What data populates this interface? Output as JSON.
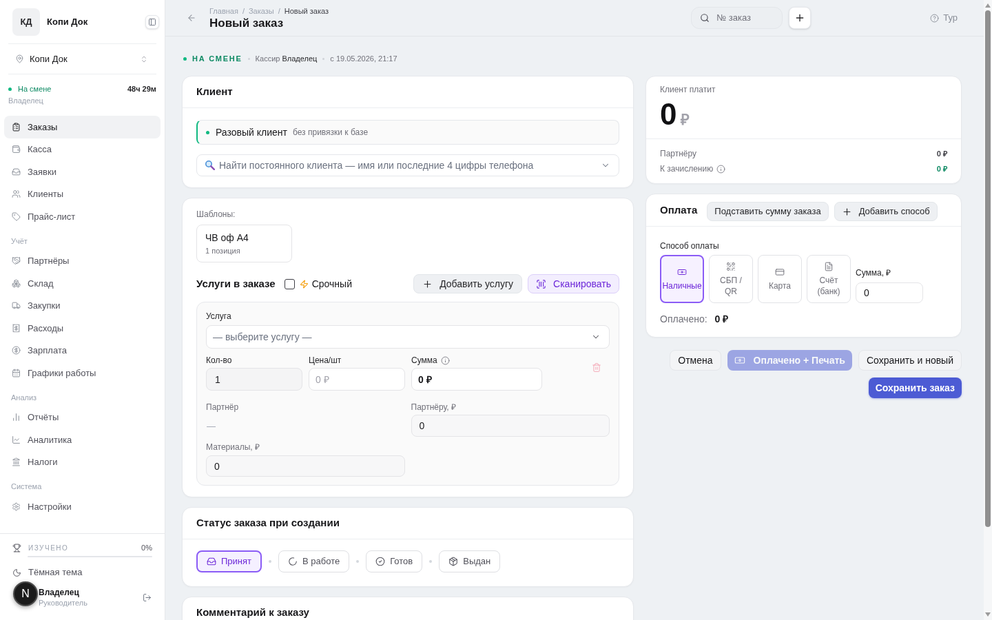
{
  "sidebar": {
    "workspace": {
      "initials": "КД",
      "name": "Копи Док"
    },
    "location": "Копи Док",
    "shift": {
      "status": "На смене",
      "duration": "48ч 29м",
      "role": "Владелец"
    },
    "nav_groups": [
      {
        "items": [
          {
            "label": "Заказы",
            "selected": true
          },
          {
            "label": "Касса",
            "selected": false
          },
          {
            "label": "Заявки",
            "selected": false
          },
          {
            "label": "Клиенты",
            "selected": false
          },
          {
            "label": "Прайс-лист",
            "selected": false
          }
        ]
      },
      {
        "title": "Учёт",
        "items": [
          {
            "label": "Партнёры",
            "selected": false
          },
          {
            "label": "Склад",
            "selected": false
          },
          {
            "label": "Закупки",
            "selected": false
          },
          {
            "label": "Расходы",
            "selected": false
          },
          {
            "label": "Зарплата",
            "selected": false
          },
          {
            "label": "Графики работы",
            "selected": false
          }
        ]
      },
      {
        "title": "Анализ",
        "items": [
          {
            "label": "Отчёты",
            "selected": false
          },
          {
            "label": "Аналитика",
            "selected": false
          },
          {
            "label": "Налоги",
            "selected": false
          }
        ]
      },
      {
        "title": "Система",
        "items": [
          {
            "label": "Настройки",
            "selected": false
          }
        ]
      }
    ],
    "progress": {
      "label": "ИЗУЧЕНО",
      "reading": "0%",
      "level": 0
    },
    "theme_toggle": "Тёмная тема",
    "user": {
      "name": "Владелец",
      "role": "Руководитель"
    }
  },
  "dev_badge": "N",
  "header": {
    "breadcrumbs": [
      "Главная",
      "Заказы",
      "Новый заказ"
    ],
    "separator": "/",
    "title": "Новый заказ",
    "search": {
      "placeholder": "№ заказ"
    },
    "tour": "Тур"
  },
  "shift_line": {
    "status": "НА СМЕНЕ",
    "cashier": "Кассир **Владелец**",
    "since": "с 19.05.2026, 21:17"
  },
  "client": {
    "title": "Клиент",
    "one_time": {
      "label": "Разовый клиент",
      "hint": "без привязки к базе"
    },
    "search": {
      "placeholder": "Найти постоянного клиента — имя или последние 4 цифры телефона"
    }
  },
  "services": {
    "templates_label": "Шаблоны:",
    "templates": [
      {
        "name": "ЧВ оф А4",
        "count": "1 позиция"
      }
    ],
    "title": "Услуги в заказе",
    "urgent": {
      "label": "Срочный",
      "checked": false
    },
    "buttons": [
      {
        "label": "Добавить услугу",
        "kind": "add"
      },
      {
        "label": "Сканировать",
        "kind": "scan"
      }
    ],
    "items": [
      {
        "service": {
          "label": "Услуга",
          "placeholder": "— выберите услугу —"
        },
        "quantity": {
          "label": "Кол-во",
          "value": "1"
        },
        "price": {
          "label": "Цена/шт",
          "placeholder": "0 ₽"
        },
        "sum": {
          "label": "Сумма",
          "value": "0 ₽"
        },
        "partner": {
          "label": "Партнёр",
          "value": "—"
        },
        "partner_share": {
          "label": "Партнёру, ₽",
          "value": "0"
        },
        "materials": {
          "label": "Материалы, ₽",
          "value": "0"
        }
      }
    ]
  },
  "order_status": {
    "title": "Статус заказа при создании",
    "steps": [
      {
        "label": "Принят",
        "selected": true
      },
      {
        "label": "В работе",
        "selected": false
      },
      {
        "label": "Готов",
        "selected": false
      },
      {
        "label": "Выдан",
        "selected": false
      }
    ]
  },
  "comment": {
    "title": "Комментарий к заказу"
  },
  "summary": {
    "label": "Клиент платит",
    "amount": "0",
    "currency": "₽",
    "rows": [
      {
        "label": "Партнёру",
        "value": "0 ₽",
        "kind": "plain",
        "info": false
      },
      {
        "label": "К зачислению",
        "value": "0 ₽",
        "kind": "payout",
        "info": true
      }
    ]
  },
  "payment": {
    "title": "Оплата",
    "buttons": [
      {
        "label": "Подставить сумму заказа",
        "kind": "fill"
      },
      {
        "label": "Добавить способ",
        "kind": "add"
      }
    ],
    "method_label": "Способ оплаты",
    "methods": [
      {
        "label": "Наличные",
        "selected": true
      },
      {
        "label": "СБП / QR",
        "selected": false
      },
      {
        "label": "Карта",
        "selected": false
      },
      {
        "label": "Счёт (банк)",
        "selected": false
      }
    ],
    "amount": {
      "label": "Сумма, ₽",
      "value": "0"
    },
    "paid": {
      "label": "Оплачено:",
      "value": "0 ₽"
    }
  },
  "actions": [
    {
      "label": "Отмена",
      "kind": "secondary",
      "disabled": false
    },
    {
      "label": "Оплачено + Печать",
      "kind": "pay",
      "disabled": true
    },
    {
      "label": "Сохранить и новый",
      "kind": "secondary",
      "disabled": false
    },
    {
      "label": "Сохранить заказ",
      "kind": "primary",
      "disabled": false
    }
  ]
}
